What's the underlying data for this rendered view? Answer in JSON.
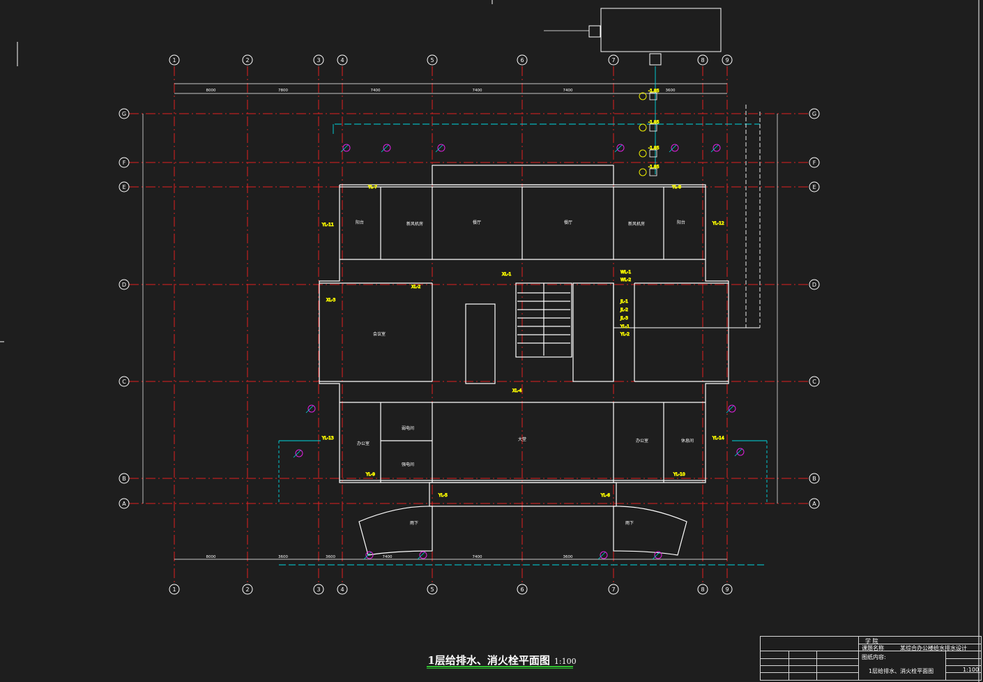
{
  "drawing_title": "1层给排水、消火栓平面图",
  "drawing_scale": "1:100",
  "axes_horizontal": [
    "1",
    "2",
    "3",
    "4",
    "5",
    "6",
    "7",
    "8",
    "9"
  ],
  "axes_vertical": [
    "G",
    "F",
    "E",
    "D",
    "C",
    "B",
    "A"
  ],
  "dimensions_top": [
    "8000",
    "7800",
    "7400",
    "7400",
    "7400",
    "3600"
  ],
  "dimensions_bottom": [
    "8000",
    "3600",
    "3600",
    "7400",
    "7400",
    "3600"
  ],
  "rooms": {
    "balcony_left": "阳台",
    "fresh_air_left": "新风机房",
    "dining_left": "餐厅",
    "dining_right": "餐厅",
    "fresh_air_right": "新风机房",
    "balcony_right": "阳台",
    "meeting_room": "会议室",
    "office_left": "办公室",
    "weak_room": "弱电间",
    "power_room": "强电间",
    "lobby": "大堂",
    "office_right": "办公室",
    "rest_room": "休息间",
    "rain_left": "雨下",
    "rain_right": "雨下"
  },
  "riser_tags": [
    "XL-1",
    "XL-2",
    "XL-3",
    "XL-4",
    "JL-1",
    "JL-2",
    "JL-3",
    "WL-1",
    "WL-2",
    "YL-1",
    "YL-2",
    "YL-5",
    "YL-6",
    "YL-7",
    "YL-8",
    "YL-9",
    "YL-10",
    "YL-11",
    "YL-12",
    "YL-13",
    "YL-14"
  ],
  "level_marks": [
    "-1.85",
    "-1.85",
    "-1.85",
    "-1.85"
  ],
  "colors": {
    "background": "#1e1e1e",
    "axis_line": "#e02020",
    "wall": "#ffffff",
    "pipe": "#00d8e0",
    "hydrant": "#e020e0",
    "level": "#f0f000",
    "title_underline": "#2fbf2f"
  },
  "title_block": {
    "school": "学 院",
    "project_label": "课题名称",
    "project_name": "某综合办公楼给水排水设计",
    "content_label": "图纸内容:",
    "content_name": "1层给排水、消火栓平面图",
    "scale": "1:100"
  }
}
